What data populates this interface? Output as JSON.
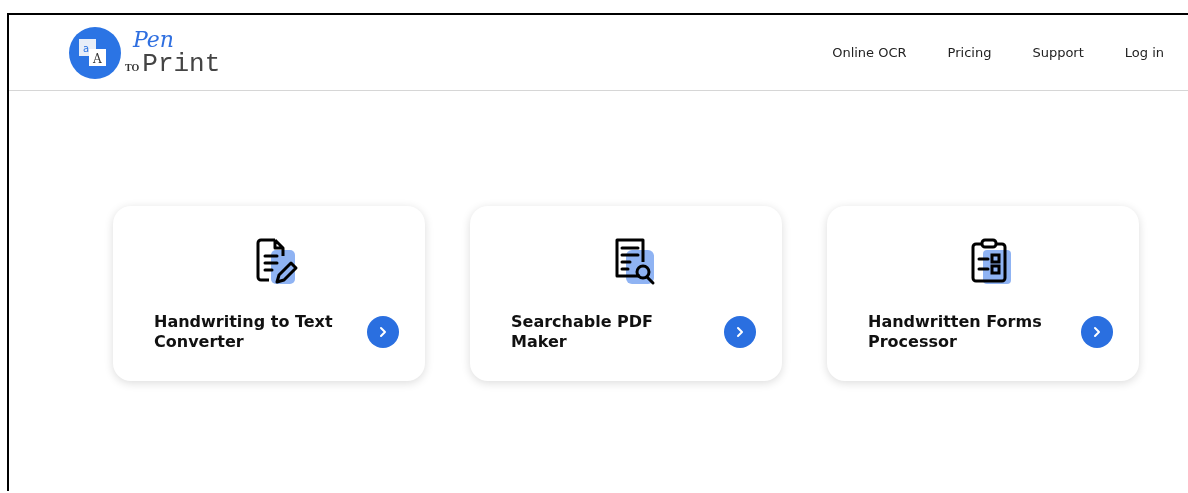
{
  "logo": {
    "mark_small": "a",
    "mark_large": "A",
    "pen": "Pen",
    "to": "TO",
    "print": "Print"
  },
  "nav": [
    {
      "label": "Online OCR"
    },
    {
      "label": "Pricing"
    },
    {
      "label": "Support"
    },
    {
      "label": "Log in"
    }
  ],
  "cards": [
    {
      "kind": "handwriting",
      "title": "Handwriting to Text Converter"
    },
    {
      "kind": "pdf",
      "title": "Searchable PDF Maker"
    },
    {
      "kind": "forms",
      "title": "Handwritten Forms Processor"
    }
  ]
}
